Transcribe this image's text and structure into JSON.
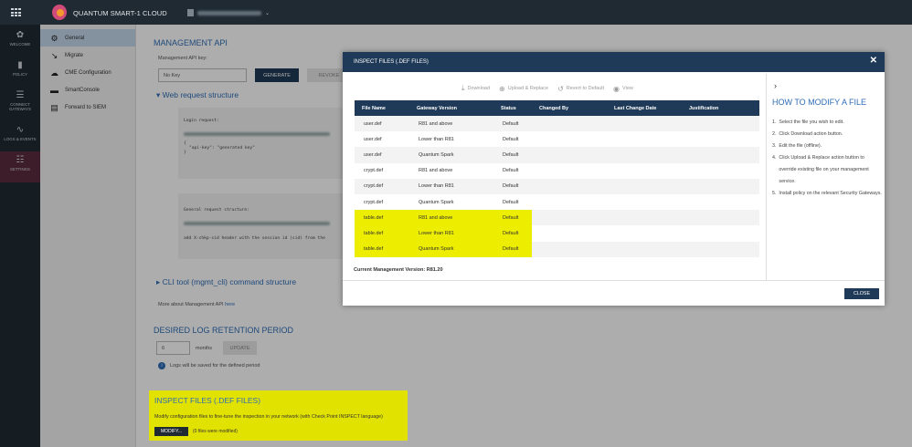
{
  "topbar": {
    "brand": "QUANTUM SMART-1 CLOUD",
    "domain_icon": "server-icon",
    "chevron": "⌄"
  },
  "leftnav": [
    {
      "label": "WELCOME",
      "icon": "flower-icon"
    },
    {
      "label": "POLICY",
      "icon": "book-icon"
    },
    {
      "label": "CONNECT GATEWAYS",
      "icon": "rack-icon"
    },
    {
      "label": "LOGS & EVENTS",
      "icon": "pulse-icon"
    },
    {
      "label": "SETTINGS",
      "icon": "sliders-icon"
    }
  ],
  "secondnav": [
    {
      "label": "General",
      "icon": "gear-icon"
    },
    {
      "label": "Migrate",
      "icon": "arrow-icon"
    },
    {
      "label": "CME Configuration",
      "icon": "cloud-icon"
    },
    {
      "label": "SmartConsole",
      "icon": "console-icon"
    },
    {
      "label": "Forward to SIEM",
      "icon": "document-icon"
    }
  ],
  "api": {
    "title": "MANAGEMENT API",
    "key_label": "Management API key:",
    "key_value": "No Key",
    "generate": "GENERATE",
    "revoke": "REVOKE",
    "web_title": "Web request structure",
    "login_request": "Login request:",
    "api_key_line": "\"api-key\": \"generated key\"",
    "brace_open": "{",
    "brace_close": "}",
    "general_request": "General request structure:",
    "header_note": "add X-chkp-sid header with the session id (sid) from the",
    "cli_title": "CLI tool (mgmt_cli) command structure",
    "more_text": "More about Management API",
    "more_link": "here"
  },
  "retention": {
    "title": "DESIRED LOG RETENTION PERIOD",
    "value": "6",
    "unit": "months",
    "update": "UPDATE",
    "info": "Logs will be saved for the defined period"
  },
  "inspect": {
    "title": "INSPECT FILES (.DEF FILES)",
    "desc": "Modify configuration files to fine-tune the inspection in your network (with Check Point INSPECT language)",
    "modify": "MODIFY...",
    "note": "(0 files were modified)"
  },
  "modal": {
    "title": "INSPECT FILES (.DEF FILES)",
    "close_icon": "close-icon",
    "toolbar": [
      {
        "label": "Download",
        "icon": "download-icon"
      },
      {
        "label": "Upload & Replace",
        "icon": "upload-icon"
      },
      {
        "label": "Revert to Default",
        "icon": "revert-icon"
      },
      {
        "label": "View",
        "icon": "eye-icon"
      }
    ],
    "columns": [
      "File Name",
      "Gateway Version",
      "Status",
      "Changed By",
      "Last Change Date",
      "Justification"
    ],
    "rows": [
      [
        "user.def",
        "R81 and above",
        "Default",
        "",
        "",
        ""
      ],
      [
        "user.def",
        "Lower than R81",
        "Default",
        "",
        "",
        ""
      ],
      [
        "user.def",
        "Quantum Spark",
        "Default",
        "",
        "",
        ""
      ],
      [
        "crypt.def",
        "R81 and above",
        "Default",
        "",
        "",
        ""
      ],
      [
        "crypt.def",
        "Lower than R81",
        "Default",
        "",
        "",
        ""
      ],
      [
        "crypt.def",
        "Quantum Spark",
        "Default",
        "",
        "",
        ""
      ],
      [
        "table.def",
        "R81 and above",
        "Default",
        "",
        "",
        ""
      ],
      [
        "table.def",
        "Lower than R81",
        "Default",
        "",
        "",
        ""
      ],
      [
        "table.def",
        "Quantum Spark",
        "Default",
        "",
        "",
        ""
      ]
    ],
    "highlighted_rows": [
      6,
      7,
      8
    ],
    "current_version": "Current Management Version: R81.20",
    "howto_title": "HOW TO MODIFY A FILE",
    "steps": [
      {
        "num": "1.",
        "text": "Select the file you wish to edit."
      },
      {
        "num": "2.",
        "text": "Click Download action button."
      },
      {
        "num": "3.",
        "text": "Edit the file (offline)."
      },
      {
        "num": "4.",
        "text": "Click Upload & Replace action button to override existing file on your management service."
      },
      {
        "num": "5.",
        "text": "Install policy on the relevant Security Gateways."
      }
    ],
    "close_button": "CLOSE"
  },
  "colors": {
    "highlight": "#e2e200",
    "navy": "#1f3a58",
    "accent_blue": "#2f6db5",
    "settings_active": "#5a2b3d"
  }
}
